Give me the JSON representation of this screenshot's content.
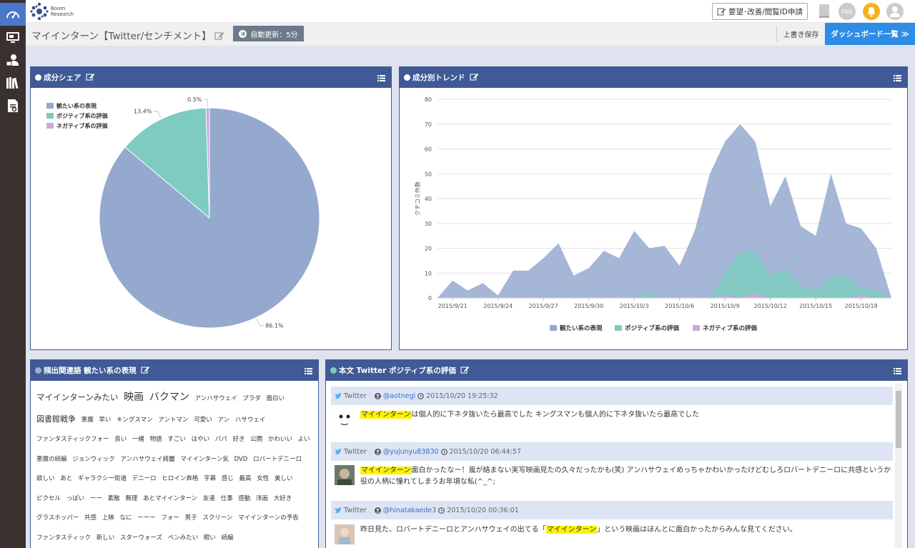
{
  "app": {
    "logo_line1": "Boom",
    "logo_line2": "Research"
  },
  "header": {
    "request_label": "要望･改善/閲覧ID申請",
    "faq_label": "FAQ"
  },
  "titlebar": {
    "title": "マイインターン【Twitter/センチメント】",
    "auto_update": "自動更新：5分",
    "save_label": "上書き保存",
    "dashboard_label": "ダッシュボード一覧 ≫"
  },
  "colors": {
    "series_watch": "#95a9cf",
    "series_positive": "#7ecbc1",
    "series_negative": "#c9a9d9",
    "panel_header": "#3f5a96",
    "highlight": "#fff200"
  },
  "panels": {
    "share": {
      "title": "成分シェア"
    },
    "trend": {
      "title": "成分別トレンド"
    },
    "words": {
      "title": "頻出関連語 観たい系の表現"
    },
    "tweets": {
      "title": "本文 Twitter ポジティブ系の評価"
    }
  },
  "chart_data": [
    {
      "type": "pie",
      "labels": [
        "観たい系の表現",
        "ポジティブ系の評価",
        "ネガティブ系の評価"
      ],
      "values": [
        86.1,
        13.4,
        0.5
      ],
      "value_labels": [
        "86.1%",
        "13.4%",
        "0.5%"
      ],
      "legend": "top-left"
    },
    {
      "type": "area",
      "ylabel": "クチコミ件数",
      "ylim": [
        0,
        80
      ],
      "yticks": [
        0,
        10,
        20,
        30,
        40,
        50,
        60,
        70,
        80
      ],
      "x": [
        "2015/9/20",
        "2015/9/21",
        "2015/9/22",
        "2015/9/23",
        "2015/9/24",
        "2015/9/25",
        "2015/9/26",
        "2015/9/27",
        "2015/9/28",
        "2015/9/29",
        "2015/9/30",
        "2015/10/1",
        "2015/10/2",
        "2015/10/3",
        "2015/10/4",
        "2015/10/5",
        "2015/10/6",
        "2015/10/7",
        "2015/10/8",
        "2015/10/9",
        "2015/10/10",
        "2015/10/11",
        "2015/10/12",
        "2015/10/13",
        "2015/10/14",
        "2015/10/15",
        "2015/10/16",
        "2015/10/17",
        "2015/10/18",
        "2015/10/19",
        "2015/10/20"
      ],
      "x_tick_labels": [
        "2015/9/21",
        "2015/9/24",
        "2015/9/27",
        "2015/9/30",
        "2015/10/3",
        "2015/10/6",
        "2015/10/9",
        "2015/10/12",
        "2015/10/15",
        "2015/10/18"
      ],
      "series": [
        {
          "name": "観たい系の表現",
          "values": [
            0,
            7,
            3,
            6,
            1,
            11,
            11,
            16,
            22,
            9,
            12,
            19,
            16,
            27,
            20,
            21,
            13,
            27,
            50,
            63,
            70,
            63,
            37,
            49,
            29,
            25,
            50,
            30,
            28,
            20,
            0
          ]
        },
        {
          "name": "ポジティブ系の評価",
          "values": [
            0,
            0,
            0,
            0,
            0,
            0,
            0,
            0,
            1,
            0,
            0,
            0,
            0,
            0,
            2,
            0,
            0,
            0,
            0,
            10,
            19,
            19,
            9,
            12,
            5,
            3,
            8,
            9,
            4,
            3,
            0
          ]
        },
        {
          "name": "ネガティブ系の評価",
          "values": [
            0,
            0,
            0,
            0,
            0,
            0,
            0,
            0,
            0,
            0,
            0,
            0,
            0,
            0,
            0,
            0,
            0,
            0,
            0,
            1,
            0,
            2,
            0,
            0,
            0,
            0,
            0,
            0,
            1,
            0,
            0
          ]
        }
      ],
      "legend": "bottom",
      "grid": true
    }
  ],
  "word_cloud": [
    {
      "text": "マイインターンみたい",
      "size": 11.5
    },
    {
      "text": "映画",
      "size": 14
    },
    {
      "text": "バクマン",
      "size": 14
    },
    {
      "text": "アンハサウェイ",
      "size": 8.5
    },
    {
      "text": "プラダ",
      "size": 8.5
    },
    {
      "text": "面白い",
      "size": 8.5
    },
    {
      "text": "図書館戦争",
      "size": 11
    },
    {
      "text": "悪魔",
      "size": 8.5
    },
    {
      "text": "早い",
      "size": 8.5
    },
    {
      "text": "キングスマン",
      "size": 8.5
    },
    {
      "text": "アントマン",
      "size": 8.5
    },
    {
      "text": "可愛い",
      "size": 8.5
    },
    {
      "text": "アン",
      "size": 8.5
    },
    {
      "text": "ハサウェイ",
      "size": 8.5
    },
    {
      "text": "ファンタスティックフォー",
      "size": 8.5
    },
    {
      "text": "良い",
      "size": 8.5
    },
    {
      "text": "一緒",
      "size": 8.5
    },
    {
      "text": "物語",
      "size": 8.5
    },
    {
      "text": "すごい",
      "size": 8.5
    },
    {
      "text": "はやい",
      "size": 8.5
    },
    {
      "text": "パパ",
      "size": 8.5
    },
    {
      "text": "好き",
      "size": 8.5
    },
    {
      "text": "公開",
      "size": 8.5
    },
    {
      "text": "かわいい",
      "size": 8.5
    },
    {
      "text": "よい",
      "size": 8.5
    },
    {
      "text": "悪魔の続編",
      "size": 8.5
    },
    {
      "text": "ジョンウィック",
      "size": 8.5
    },
    {
      "text": "アンハサウェイ綺麗",
      "size": 8.5
    },
    {
      "text": "マイインターン気",
      "size": 8.5
    },
    {
      "text": "DVD",
      "size": 8.5
    },
    {
      "text": "ロバートデニーロ",
      "size": 8.5
    },
    {
      "text": "欲しい",
      "size": 8.5
    },
    {
      "text": "あと",
      "size": 8.5
    },
    {
      "text": "ギャラクシー街道",
      "size": 8.5
    },
    {
      "text": "デニーロ",
      "size": 8.5
    },
    {
      "text": "ヒロイン奔格",
      "size": 8.5
    },
    {
      "text": "字幕",
      "size": 8.5
    },
    {
      "text": "感じ",
      "size": 8.5
    },
    {
      "text": "最高",
      "size": 8.5
    },
    {
      "text": "女性",
      "size": 8.5
    },
    {
      "text": "美しい",
      "size": 8.5
    },
    {
      "text": "ピクセル",
      "size": 8.5
    },
    {
      "text": "っぽい",
      "size": 8.5
    },
    {
      "text": "ーー",
      "size": 8.5
    },
    {
      "text": "素敵",
      "size": 8.5
    },
    {
      "text": "無理",
      "size": 8.5
    },
    {
      "text": "あとマイインターン",
      "size": 8.5
    },
    {
      "text": "友達",
      "size": 8.5
    },
    {
      "text": "仕事",
      "size": 8.5
    },
    {
      "text": "感動",
      "size": 8.5
    },
    {
      "text": "洋画",
      "size": 8.5
    },
    {
      "text": "大好き",
      "size": 8.5
    },
    {
      "text": "グラスホッパー",
      "size": 8.5
    },
    {
      "text": "共感",
      "size": 8.5
    },
    {
      "text": "上映",
      "size": 8.5
    },
    {
      "text": "なに",
      "size": 8.5
    },
    {
      "text": "ーーー",
      "size": 8.5
    },
    {
      "text": "フォー",
      "size": 8.5
    },
    {
      "text": "男子",
      "size": 8.5
    },
    {
      "text": "スクリーン",
      "size": 8.5
    },
    {
      "text": "マイインターンの予告",
      "size": 8.5
    },
    {
      "text": "ファンタスティック",
      "size": 8.5
    },
    {
      "text": "新しい",
      "size": 8.5
    },
    {
      "text": "スターウォーズ",
      "size": 8.5
    },
    {
      "text": "ベンみたい",
      "size": 8.5
    },
    {
      "text": "眼い",
      "size": 8.5
    },
    {
      "text": "続編",
      "size": 8.5
    }
  ],
  "tweets": [
    {
      "source": "Twitter",
      "account": "@aotnegi",
      "time": "2015/10/20 19:25:32",
      "keyword": "マイインターン",
      "text_before": "",
      "text_after": "は個人的に下ネタ抜いたら最高でした キングスマンも個人的に下ネタ抜いたら最高でした"
    },
    {
      "source": "Twitter",
      "account": "@yujunyu83830",
      "time": "2015/10/20 06:44:57",
      "keyword": "マイインターン",
      "text_before": "",
      "text_after": "面白かったなー！嵐が絡まない実写映画見たの久々だったかも(笑) アンハサウェイめっちゃかわいかったけどむしろロバートデニーロに共感というか役の人柄に憧れてしまうお年頃な私(^_^;"
    },
    {
      "source": "Twitter",
      "account": "@hinatakaede3",
      "time": "2015/10/20 00:36:01",
      "keyword": "マイインターン",
      "text_before": "昨日見た、ロバートデニーロとアンハサウェイの出てる「",
      "text_after": "」という映画はほんとに面白かったからみんな見てください。"
    }
  ]
}
